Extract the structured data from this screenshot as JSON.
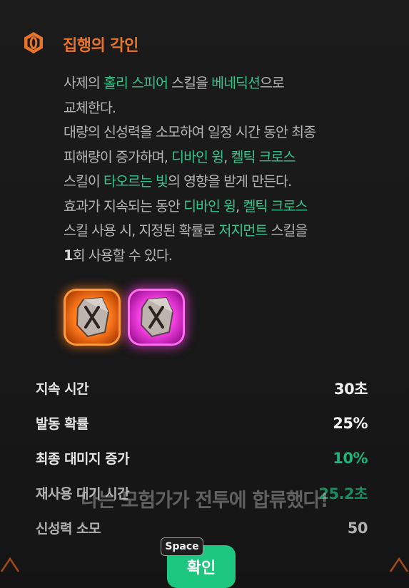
{
  "title": "집행의 각인",
  "description": [
    [
      {
        "t": "사제의 "
      },
      {
        "t": "홀리 스피어",
        "hl": true
      },
      {
        "t": " 스킬을 "
      },
      {
        "t": "베네딕션",
        "hl": true
      },
      {
        "t": "으로"
      }
    ],
    [
      {
        "t": "교체한다."
      }
    ],
    [
      {
        "t": "대량의 신성력을 소모하여 일정 시간 동안 최종"
      }
    ],
    [
      {
        "t": "피해량이 증가하며, "
      },
      {
        "t": "디바인 윙",
        "hl": true
      },
      {
        "t": ", "
      },
      {
        "t": "켈틱 크로스",
        "hl": true
      }
    ],
    [
      {
        "t": "스킬이 "
      },
      {
        "t": "타오르는 빛",
        "hl": true
      },
      {
        "t": "의 영향을 받게 만든다."
      }
    ],
    [
      {
        "t": "효과가 지속되는 동안 "
      },
      {
        "t": "디바인 윙",
        "hl": true
      },
      {
        "t": ", "
      },
      {
        "t": "켈틱 크로스",
        "hl": true
      }
    ],
    [
      {
        "t": "스킬 사용 시, 지정된 확률로 "
      },
      {
        "t": "저지먼트",
        "hl": true
      },
      {
        "t": " 스킬을"
      }
    ],
    [
      {
        "t": "1",
        "num": true
      },
      {
        "t": "회 사용할 수 있다."
      }
    ]
  ],
  "runes": [
    {
      "name": "rune-orange",
      "color": "#ff7a1e"
    },
    {
      "name": "rune-pink",
      "color": "#f23ee0"
    }
  ],
  "stats": [
    {
      "label": "지속 시간",
      "value": "30초",
      "green": false
    },
    {
      "label": "발동 확률",
      "value": "25%",
      "green": false
    },
    {
      "label": "최종 대미지 증가",
      "value": "10%",
      "green": true
    },
    {
      "label": "재사용 대기 시간",
      "value": "25.2초",
      "green": true
    },
    {
      "label": "신성력 소모",
      "value": "50",
      "green": false
    }
  ],
  "toast": "나는 모험가가 전투에 합류했다!",
  "space_key": "Space",
  "confirm_label": "확인",
  "colors": {
    "accent": "#e8742a",
    "highlight": "#35c48a",
    "confirm": "#1ec77f"
  }
}
